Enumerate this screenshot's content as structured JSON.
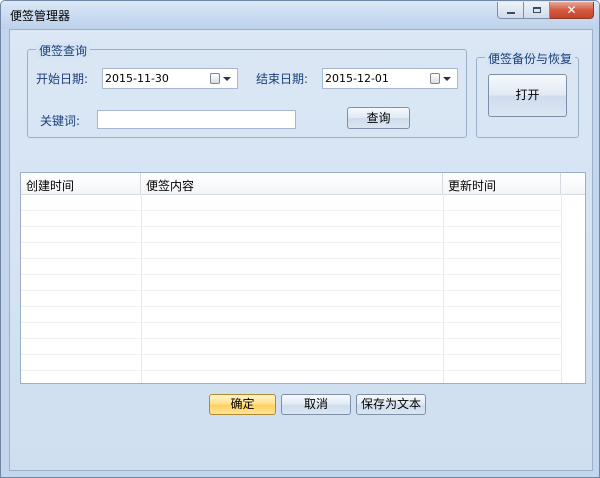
{
  "window": {
    "title": "便签管理器"
  },
  "query": {
    "group_title": "便签查询",
    "start_label": "开始日期:",
    "start_value": "2015-11-30",
    "end_label": "结束日期:",
    "end_value": "2015-12-01",
    "keyword_label": "关键词:",
    "keyword_value": "",
    "search_label": "查询"
  },
  "backup": {
    "group_title": "便签备份与恢复",
    "open_label": "打开"
  },
  "table": {
    "columns": [
      "创建时间",
      "便签内容",
      "更新时间"
    ],
    "rows": []
  },
  "actions": {
    "ok_label": "确定",
    "cancel_label": "取消",
    "save_text_label": "保存为文本"
  }
}
